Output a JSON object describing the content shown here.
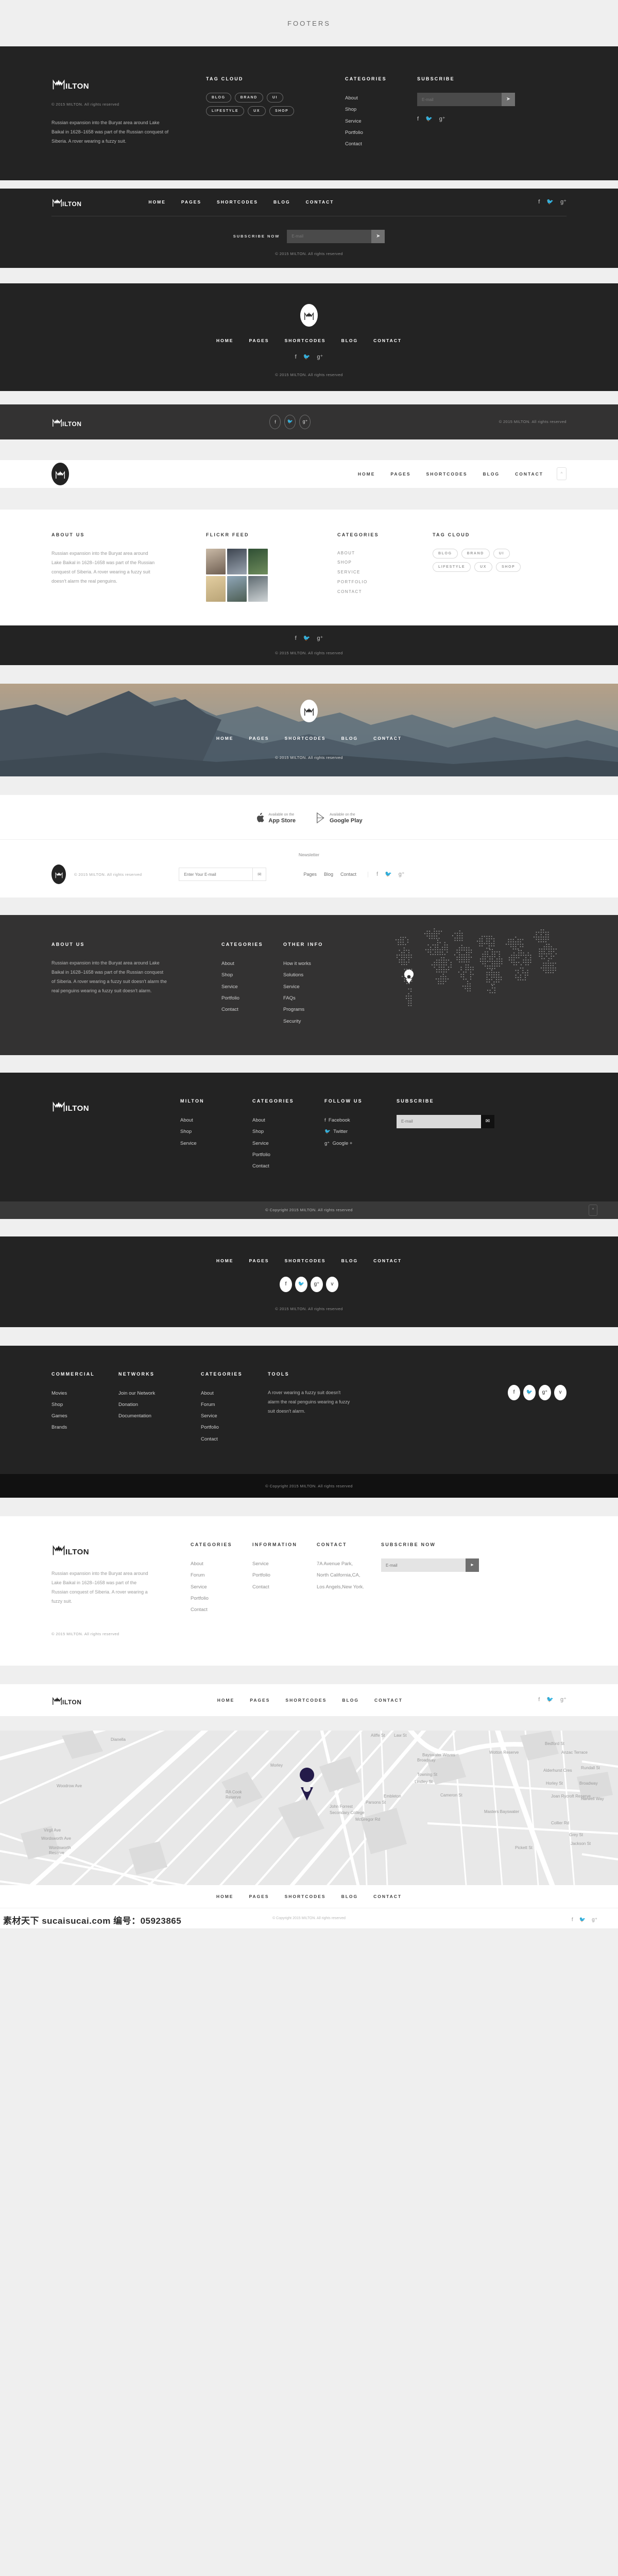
{
  "page": {
    "title": "FOOTERS"
  },
  "brand": {
    "name_mark": "M",
    "name_rest": "ILTON",
    "full": "MILTON"
  },
  "common": {
    "copyright": "© 2015 MILTON. All rights reserved",
    "copyright_long": "© Copyright 2015 MILTON. All rights reserved",
    "nav": [
      "HOME",
      "PAGES",
      "SHORTCODES",
      "BLOG",
      "CONTACT"
    ],
    "email_placeholder": "E-mail",
    "send_icon": "paper-plane-icon",
    "social": [
      "facebook-icon",
      "twitter-icon",
      "google-plus-icon"
    ],
    "social_glyphs": [
      "f",
      "🐦",
      "g+"
    ],
    "about_text": "Russian expansion into the Buryat area around Lake Baikal in 1628–1658 was part of the Russian conquest of Siberia. A rover wearing a fuzzy suit."
  },
  "footer1": {
    "copyright": "© 2015 MILTON. All rights reserved",
    "description": "Russian expansion into the Buryat area around Lake Baikal in 1628–1658 was part of the Russian conquest of Siberia. A rover wearing a fuzzy suit.",
    "tagcloud_title": "TAG CLOUD",
    "tags": [
      "BLOG",
      "BRAND",
      "UI",
      "LIFESTYLE",
      "UX",
      "SHOP"
    ],
    "categories_title": "CATEGORIES",
    "categories": [
      "About",
      "Shop",
      "Service",
      "Portfolio",
      "Contact"
    ],
    "subscribe_title": "SUBSCRIBE",
    "email_placeholder": "E-mail"
  },
  "footer2": {
    "nav": [
      "HOME",
      "PAGES",
      "SHORTCODES",
      "BLOG",
      "CONTACT"
    ],
    "subscribe_label": "SUBSCRIBE NOW",
    "email_placeholder": "E-mail",
    "copyright": "© 2015 MILTON. All rights reserved"
  },
  "footer3": {
    "nav": [
      "HOME",
      "PAGES",
      "SHORTCODES",
      "BLOG",
      "CONTACT"
    ],
    "copyright": "© 2015 MILTON. All rights reserved"
  },
  "footer4": {
    "copyright": "© 2015 MILTON. All rights reserved"
  },
  "footer5": {
    "nav": [
      "HOME",
      "PAGES",
      "SHORTCODES",
      "BLOG",
      "CONTACT"
    ],
    "about_title": "ABOUT US",
    "about_text": "Russian expansion into the Buryat area around Lake Baikal in 1628–1658 was part of the Russian conquest of Siberia. A rover wearing a fuzzy suit doesn't alarm the real penguins.",
    "flickr_title": "FLICKR FEED",
    "categories_title": "CATEGORIES",
    "categories": [
      "ABOUT",
      "SHOP",
      "SERVICE",
      "PORTFOLIO",
      "CONTACT"
    ],
    "tagcloud_title": "TAG CLOUD",
    "tags": [
      "BLOG",
      "BRAND",
      "UI",
      "LIFESTYLE",
      "UX",
      "SHOP"
    ],
    "copyright": "© 2015 MILTON. All rights reserved",
    "back_to_top": "^"
  },
  "footer6": {
    "nav": [
      "HOME",
      "PAGES",
      "SHORTCODES",
      "BLOG",
      "CONTACT"
    ],
    "copyright": "© 2015 MILTON. All rights reserved"
  },
  "footer7": {
    "appstore_small": "Available on the",
    "appstore_big": "App Store",
    "googleplay_small": "Available on the",
    "googleplay_big": "Google Play",
    "newsletter_label": "Newsletter",
    "newsletter_placeholder": "Enter Your E-mail",
    "copyright": "© 2015 MILTON. All rights reserved",
    "links": [
      "Pages",
      "Blog",
      "Contact"
    ]
  },
  "footer8": {
    "about_title": "ABOUT US",
    "about_text": "Russian expansion into the Buryat area around Lake Baikal in 1628–1658 was part of the Russian conquest of Siberia. A rover wearing a fuzzy suit doesn't alarm the real penguins wearing a fuzzy suit doesn't alarm.",
    "categories_title": "CATEGORIES",
    "categories": [
      "About",
      "Shop",
      "Service",
      "Portfolio",
      "Contact"
    ],
    "otherinfo_title": "OTHER INFO",
    "otherinfo": [
      "How it works",
      "Solutions",
      "Service",
      "FAQs",
      "Programs",
      "Security"
    ],
    "map_pin": "location-pin-icon"
  },
  "footer9": {
    "col1_title": "MILTON",
    "col1": [
      "About",
      "Shop",
      "Service"
    ],
    "col2_title": "CATEGORIES",
    "col2": [
      "About",
      "Shop",
      "Service",
      "Portfolio",
      "Contact"
    ],
    "col3_title": "FOLLOW US",
    "col3": [
      "Facebook",
      "Twitter",
      "Google +"
    ],
    "col4_title": "SUBSCRIBE",
    "email_placeholder": "E-mail",
    "copyright": "© Copyright 2015 MILTON. All rights reserved",
    "back_to_top": "^"
  },
  "footer10": {
    "nav": [
      "HOME",
      "PAGES",
      "SHORTCODES",
      "BLOG",
      "CONTACT"
    ],
    "social": [
      "f",
      "t",
      "g+",
      "v"
    ],
    "copyright": "© 2015 MILTON. All rights reserved"
  },
  "footer11": {
    "col1_title": "COMMERCIAL",
    "col1": [
      "Movies",
      "Shop",
      "Games",
      "Brands"
    ],
    "col2_title": "NETWORKS",
    "col2": [
      "Join our Network",
      "Donation",
      "Documentation"
    ],
    "col3_title": "CATEGORIES",
    "col3": [
      "About",
      "Forum",
      "Service",
      "Portfolio",
      "Contact"
    ],
    "col4_title": "TOOLS",
    "col4_text": "A rover wearing a fuzzy suit doesn't alarm the real penguins wearing a fuzzy suit doesn't alarm.",
    "social": [
      "f",
      "t",
      "g+",
      "v"
    ],
    "copyright": "© Copyright 2015 MILTON. All rights reserved"
  },
  "footer12": {
    "about_text": "Russian expansion into the Buryat area around Lake Baikal in 1628–1658 was part of the Russian conquest of Siberia. A rover wearing a fuzzy suit.",
    "col1_title": "CATEGORIES",
    "col1": [
      "About",
      "Forum",
      "Service",
      "Portfolio",
      "Contact"
    ],
    "col2_title": "INFORMATION",
    "col2": [
      "Service",
      "Portfolio",
      "Contact"
    ],
    "col3_title": "CONTACT",
    "col3": [
      "7A Avenue Park,",
      "North California,CA,",
      "Los Angels,New York."
    ],
    "col4_title": "SUBSCRIBE NOW",
    "email_placeholder": "E-mail",
    "copyright": "© 2015 MILTON. All rights reserved"
  },
  "footer13": {
    "nav": [
      "HOME",
      "PAGES",
      "SHORTCODES",
      "BLOG",
      "CONTACT"
    ]
  },
  "footer14": {
    "nav": [
      "HOME",
      "PAGES",
      "SHORTCODES",
      "BLOG",
      "CONTACT"
    ],
    "copyright": "© Copyright 2015 MILTON. All rights reserved",
    "map_pin": "location-pin-icon",
    "map_labels": [
      "Dianella",
      "Morley",
      "Embleton",
      "Bayswater Waves",
      "Wotton Reserve",
      "Houghton Park",
      "Bedford St",
      "Anzac Terrace",
      "Rundall St",
      "Alderhurst Cres",
      "Horley St",
      "Broadway",
      "Joan Rycroft Reserve",
      "Harwell Way",
      "Masters Bayswater",
      "Collier Rd",
      "Pickett St",
      "John Forrest Secondary College",
      "RA Cook Reserve",
      "Wordsworth Reserve",
      "Wordsworth Ave",
      "Woodrow Ave",
      "Virgil Ave",
      "Walter Rd W",
      "Crimea St",
      "Aliffe St",
      "Law St",
      "Towning St",
      "Lindley St",
      "Cameron St",
      "Parsons St",
      "McGregor Rd",
      "Grey St",
      "Jackson St"
    ]
  },
  "watermark": {
    "text": "素材天下 sucaisucai.com 编号：05923865"
  }
}
